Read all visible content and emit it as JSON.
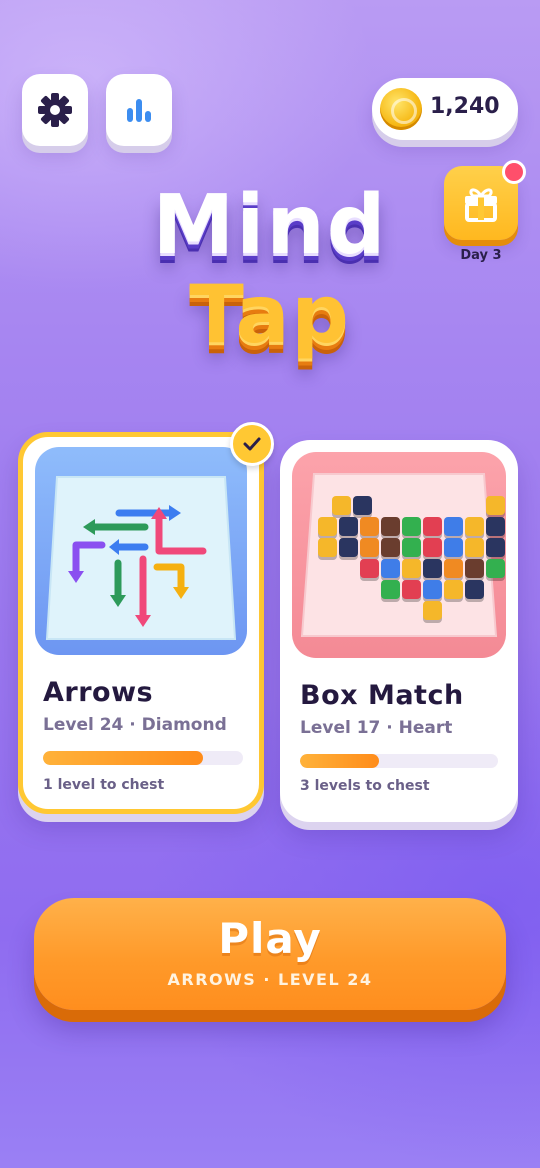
{
  "header": {
    "settings_icon": "gear-icon",
    "stats_icon": "bar-chart-icon",
    "coins": "1,240",
    "daily_reward": {
      "icon": "gift-icon",
      "label": "Day 3",
      "has_notification": true
    }
  },
  "title": {
    "line1": "Mind",
    "line2": "Tap"
  },
  "games": [
    {
      "name": "Arrows",
      "subtitle": "Level 24 · Diamond",
      "progress": 0.8,
      "chest_text": "1 level to chest",
      "selected": true,
      "art_colors": {
        "bg": "#7ea9f7",
        "tile": "#e6f6ff"
      }
    },
    {
      "name": "Box Match",
      "subtitle": "Level 17 · Heart",
      "progress": 0.4,
      "chest_text": "3 levels to chest",
      "selected": false,
      "art_colors": {
        "bg": "#f99aa3",
        "tile": "#ffd9dd"
      }
    }
  ],
  "play_button": {
    "label": "Play",
    "sublabel": "ARROWS · LEVEL 24"
  },
  "colors": {
    "accent_orange": "#ff9a2a",
    "accent_yellow": "#ffc833",
    "bg_purple": "#9a77ee"
  }
}
